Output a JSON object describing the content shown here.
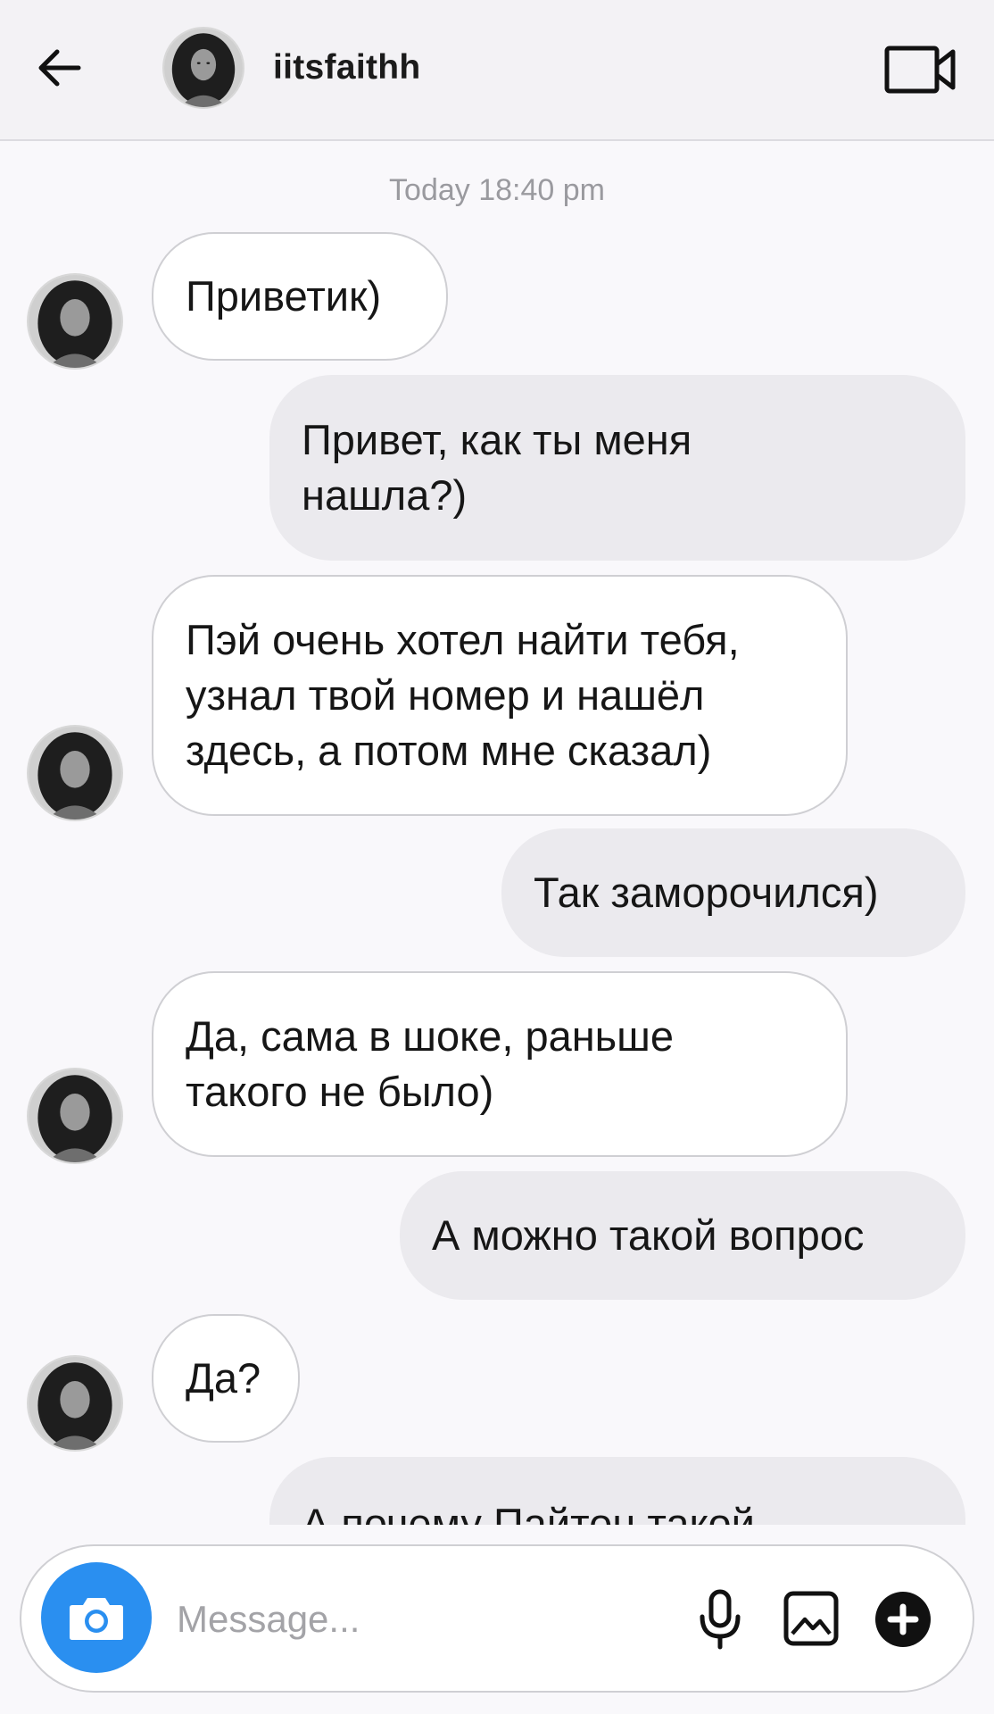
{
  "header": {
    "back_icon": "arrow-left-icon",
    "username": "iitsfaithh",
    "video_icon": "video-camera-icon"
  },
  "chat": {
    "timestamp": "Today 18:40 pm",
    "messages": [
      {
        "direction": "in",
        "text": "Приветик)"
      },
      {
        "direction": "out",
        "text": "Привет, как ты меня\nнашла?)"
      },
      {
        "direction": "in",
        "text": "Пэй очень хотел найти тебя,\nузнал твой номер и нашёл\nздесь, а потом мне сказал)"
      },
      {
        "direction": "out",
        "text": "Так заморочился)"
      },
      {
        "direction": "in",
        "text": "Да, сама в шоке, раньше\nтакого не было)"
      },
      {
        "direction": "out",
        "text": "А можно такой вопрос"
      },
      {
        "direction": "in",
        "text": "Да?"
      },
      {
        "direction": "out",
        "text": "А почему Пайтон такой"
      }
    ]
  },
  "composer": {
    "camera_icon": "camera-icon",
    "placeholder": "Message...",
    "mic_icon": "microphone-icon",
    "gallery_icon": "image-gallery-icon",
    "plus_icon": "plus-circle-icon"
  },
  "colors": {
    "accent": "#2a8ff0",
    "header_bg": "#f3f2f5",
    "incoming_bubble": "#ffffff",
    "outgoing_bubble": "#ebeaee",
    "timestamp": "#9a9a9f"
  }
}
